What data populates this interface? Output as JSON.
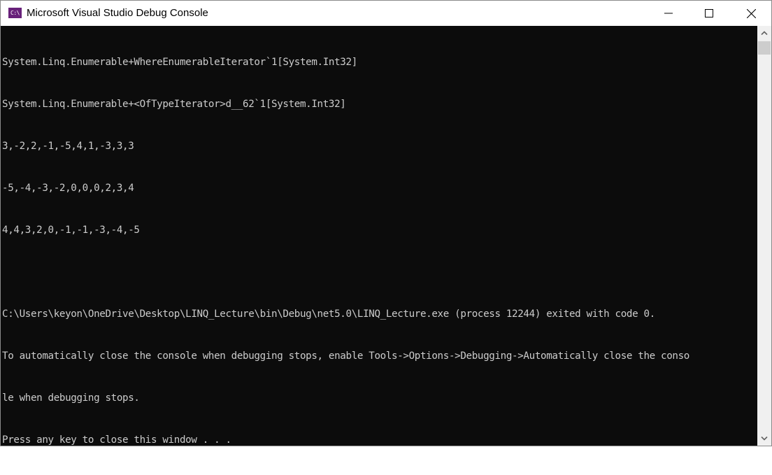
{
  "window": {
    "title": "Microsoft Visual Studio Debug Console",
    "icon_label": "C:\\",
    "controls": [
      "minimize",
      "maximize",
      "close"
    ]
  },
  "console": {
    "lines": [
      "System.Linq.Enumerable+WhereEnumerableIterator`1[System.Int32]",
      "System.Linq.Enumerable+<OfTypeIterator>d__62`1[System.Int32]",
      "3,-2,2,-1,-5,4,1,-3,3,3",
      "-5,-4,-3,-2,0,0,0,2,3,4",
      "4,4,3,2,0,-1,-1,-3,-4,-5",
      "",
      "C:\\Users\\keyon\\OneDrive\\Desktop\\LINQ_Lecture\\bin\\Debug\\net5.0\\LINQ_Lecture.exe (process 12244) exited with code 0.",
      "To automatically close the console when debugging stops, enable Tools->Options->Debugging->Automatically close the conso",
      "le when debugging stops.",
      "Press any key to close this window . . ."
    ]
  },
  "colors": {
    "console_bg": "#0c0c0c",
    "console_fg": "#cccccc",
    "icon_bg": "#68217a"
  }
}
